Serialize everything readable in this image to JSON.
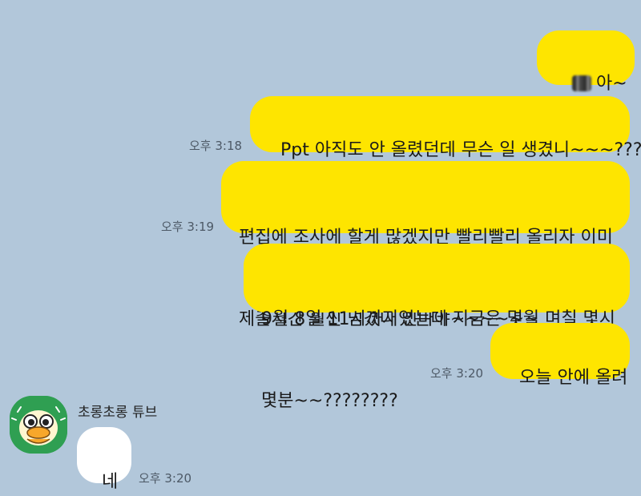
{
  "messages": {
    "m1": {
      "prefix_icon": "blurred-name",
      "text": "아~"
    },
    "m2": {
      "text": "Ppt 아직도 안 올렸던데 무슨 일 생겼니~~~???",
      "time": "오후 3:18"
    },
    "m3": {
      "line1": "편집에 조사에 할게 많겠지만 빨리빨리 올리자 이미",
      "line2": "제출시간 훨씬 넘겼다 인마야~~~~~~",
      "time": "오후 3:19"
    },
    "m4": {
      "line1": "9월 8일 11시까지였는데 지금은 몇월 며칠 몇시",
      "line2": "몇분~~????????"
    },
    "m5": {
      "text": "오늘 안에 올려",
      "time": "오후 3:20"
    },
    "reply": {
      "sender": "초롱초롱 튜브",
      "text": "네",
      "time": "오후 3:20",
      "avatar_icon": "tube-duck-avatar-icon"
    }
  },
  "colors": {
    "background": "#b2c7da",
    "outgoing_bubble": "#fee500",
    "incoming_bubble": "#ffffff",
    "avatar_bg": "#2f9f52"
  }
}
